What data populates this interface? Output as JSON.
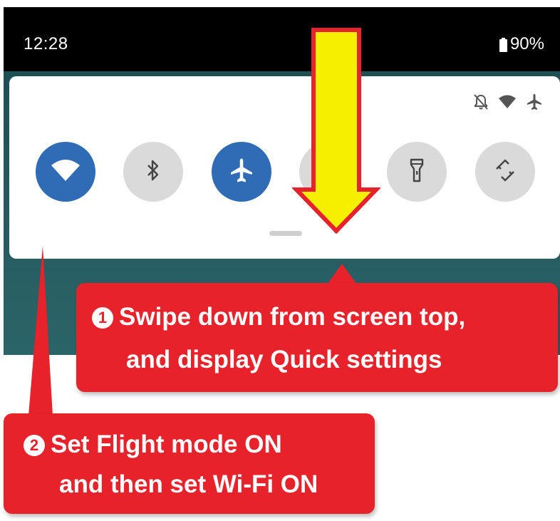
{
  "status_bar": {
    "time": "12:28",
    "battery": "90%"
  },
  "quick_settings": {
    "status_icons": [
      "do-not-disturb-off-icon",
      "wifi-icon",
      "airplane-icon"
    ],
    "tiles": [
      {
        "name": "wifi",
        "icon": "wifi-icon",
        "state": "on"
      },
      {
        "name": "bluetooth",
        "icon": "bluetooth-icon",
        "state": "off"
      },
      {
        "name": "flight-mode",
        "icon": "airplane-icon",
        "state": "on"
      },
      {
        "name": "hidden",
        "icon": "unknown-icon",
        "state": "off"
      },
      {
        "name": "flashlight",
        "icon": "flashlight-icon",
        "state": "off"
      },
      {
        "name": "auto-rotate",
        "icon": "rotate-icon",
        "state": "off"
      }
    ]
  },
  "callouts": {
    "step1": {
      "number": "1",
      "line1": "Swipe down from screen top,",
      "line2": "and display Quick settings"
    },
    "step2": {
      "number": "2",
      "line1": "Set Flight mode ON",
      "line2": "and then set Wi-Fi ON"
    }
  },
  "colors": {
    "tile_on": "#2f6cb5",
    "tile_off": "#dadada",
    "callout": "#e8222a",
    "arrow_fill": "#f5f000",
    "arrow_stroke": "#e8222a"
  }
}
